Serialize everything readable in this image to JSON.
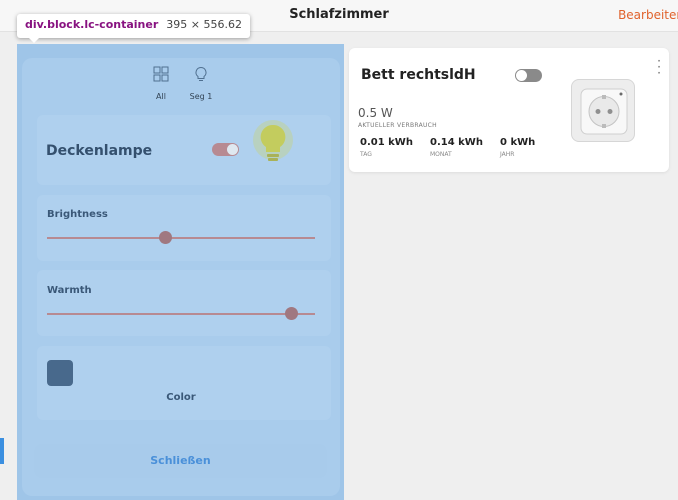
{
  "header": {
    "title": "Schlafzimmer",
    "edit_label": "Bearbeiten"
  },
  "inspector_tooltip": {
    "selector": "div.block.lc-container",
    "dimensions": "395 × 556.62"
  },
  "segments": [
    {
      "label": "All",
      "icon": "grid-icon"
    },
    {
      "label": "Seg 1",
      "icon": "bulb-outline-icon"
    }
  ],
  "light": {
    "name": "Deckenlampe",
    "on": true,
    "brightness_label": "Brightness",
    "brightness_level": 0.44,
    "warmth_label": "Warmth",
    "warmth_level": 0.91,
    "color_label": "Color",
    "color": "#48698c",
    "close_label": "Schließen"
  },
  "plug": {
    "name": "Bett rechtsldH",
    "on": false,
    "power": "0.5 W",
    "power_label": "AKTUELLER VERBRAUCH",
    "stats": [
      {
        "value": "0.01 kWh",
        "label": "TAG"
      },
      {
        "value": "0.14 kWh",
        "label": "MONAT"
      },
      {
        "value": "0 kWh",
        "label": "JAHR"
      }
    ]
  },
  "colors": {
    "accent": "#e0622c",
    "highlight": "#9fc5e8",
    "toggle_on": "#b78a92"
  }
}
